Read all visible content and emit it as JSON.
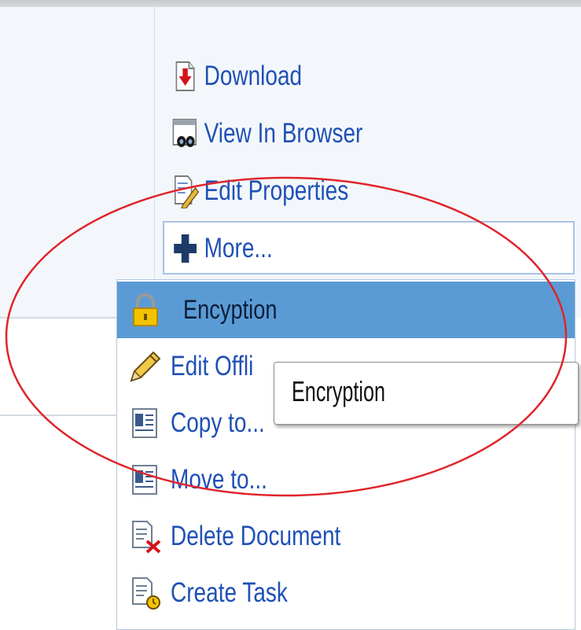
{
  "actions": {
    "download": "Download",
    "view_in_browser": "View In Browser",
    "edit_properties": "Edit Properties",
    "more": "More..."
  },
  "menu": {
    "items": [
      {
        "label": "Encyption",
        "icon": "lock-icon",
        "selected": true
      },
      {
        "label": "Edit Offli",
        "icon": "pencil-icon"
      },
      {
        "label": "Copy to...",
        "icon": "copy-document-icon"
      },
      {
        "label": "Move to...",
        "icon": "move-document-icon"
      },
      {
        "label": "Delete Document",
        "icon": "delete-document-icon"
      },
      {
        "label": "Create Task",
        "icon": "create-task-icon"
      }
    ]
  },
  "tooltip": {
    "text": "Encryption"
  },
  "annotation": {
    "shape": "ellipse",
    "color": "#e0242b"
  }
}
